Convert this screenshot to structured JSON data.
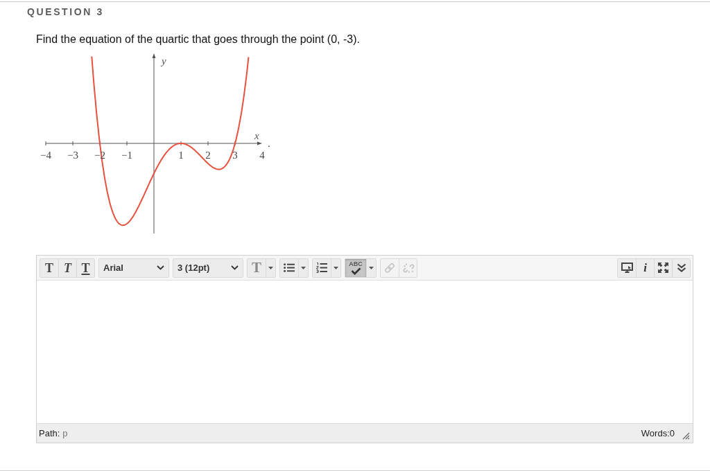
{
  "question": {
    "heading": "QUESTION 3",
    "prompt": "Find the equation of the quartic that goes through the point (0, -3)."
  },
  "figure": {
    "y_label": "y",
    "x_label": "x",
    "x_tick_labels": [
      "−4",
      "−3",
      "−2",
      "−1",
      "1",
      "2",
      "3",
      "4"
    ],
    "end_mark": "."
  },
  "editor": {
    "toolbar_left": [
      [
        {
          "kind": "bold",
          "glyph": "T",
          "menu": false,
          "active": false,
          "disabled": false
        },
        {
          "kind": "italic",
          "glyph": "T",
          "menu": false,
          "active": false,
          "disabled": false
        },
        {
          "kind": "underline",
          "glyph": "T",
          "menu": false,
          "active": false,
          "disabled": false
        }
      ],
      [
        {
          "kind": "dropdown",
          "value": "Arial",
          "menu": true,
          "active": false,
          "disabled": false
        }
      ],
      [
        {
          "kind": "dropdown",
          "value": "3 (12pt)",
          "menu": true,
          "active": false,
          "disabled": false
        }
      ],
      [
        {
          "kind": "textcolor",
          "glyph": "T",
          "menu": true,
          "active": false,
          "disabled": false
        }
      ],
      [
        {
          "kind": "bullets",
          "menu": true,
          "active": false,
          "disabled": false
        }
      ],
      [
        {
          "kind": "numbering",
          "menu": true,
          "active": false,
          "disabled": false
        }
      ],
      [
        {
          "kind": "spellcheck",
          "label": "ABC",
          "menu": true,
          "active": true,
          "disabled": false
        }
      ],
      [
        {
          "kind": "link",
          "menu": false,
          "active": false,
          "disabled": true
        },
        {
          "kind": "unlink",
          "menu": false,
          "active": false,
          "disabled": true
        }
      ]
    ],
    "toolbar_right": [
      [
        {
          "kind": "preview",
          "menu": false,
          "active": false,
          "disabled": false
        },
        {
          "kind": "info",
          "glyph": "i",
          "menu": false,
          "active": false,
          "disabled": false
        },
        {
          "kind": "fullscreen",
          "menu": false,
          "active": false,
          "disabled": false
        },
        {
          "kind": "more",
          "menu": false,
          "active": false,
          "disabled": false
        }
      ]
    ],
    "status_bar": {
      "path_label": "Path:",
      "path_value": "p",
      "word_count": "Words:0"
    }
  }
}
